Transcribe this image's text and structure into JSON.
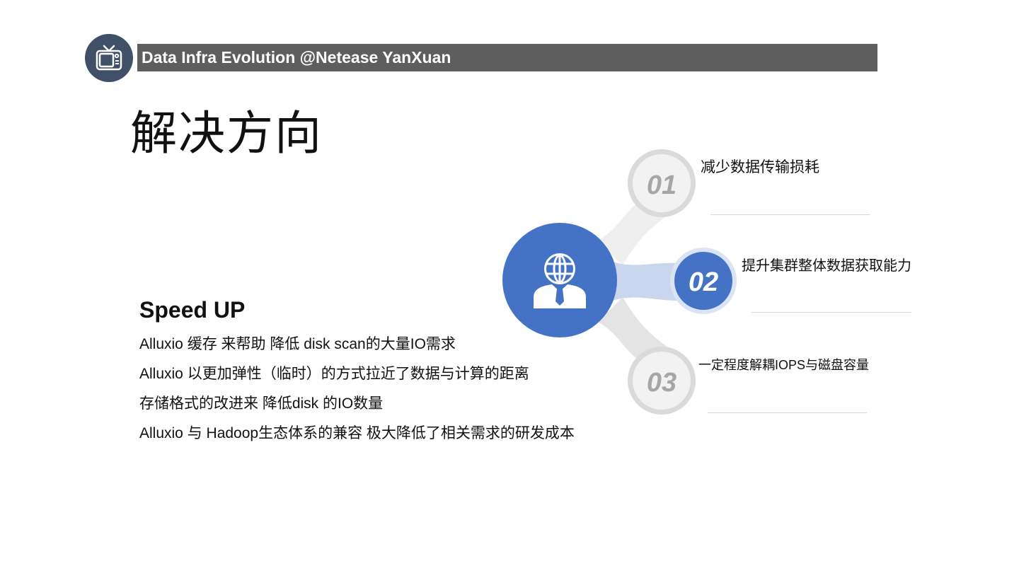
{
  "header": {
    "title": "Data Infra Evolution @Netease YanXuan",
    "logo_icon": "tv-icon"
  },
  "slide": {
    "title": "解决方向",
    "section_title": "Speed UP",
    "bullets": [
      "Alluxio  缓存 来帮助 降低 disk scan的大量IO需求",
      "Alluxio  以更加弹性（临时）的方式拉近了数据与计算的距离",
      "存储格式的改进来 降低disk 的IO数量",
      "Alluxio 与 Hadoop生态体系的兼容 极大降低了相关需求的研发成本"
    ]
  },
  "diagram": {
    "hub_icon": "globe-person-icon",
    "items": [
      {
        "number": "01",
        "label": "减少数据传输损耗",
        "highlighted": false
      },
      {
        "number": "02",
        "label": "提升集群整体数据获取能力",
        "highlighted": true
      },
      {
        "number": "03",
        "label": "一定程度解耦IOPS与磁盘容量",
        "highlighted": false
      }
    ]
  },
  "colors": {
    "header_bg": "#5e5e5e",
    "logo_bg": "#3f5068",
    "accent_blue": "#4472c4",
    "grey_node": "#f2f2f2",
    "grey_ring": "#dadada",
    "grey_number": "#a6a6a6"
  }
}
